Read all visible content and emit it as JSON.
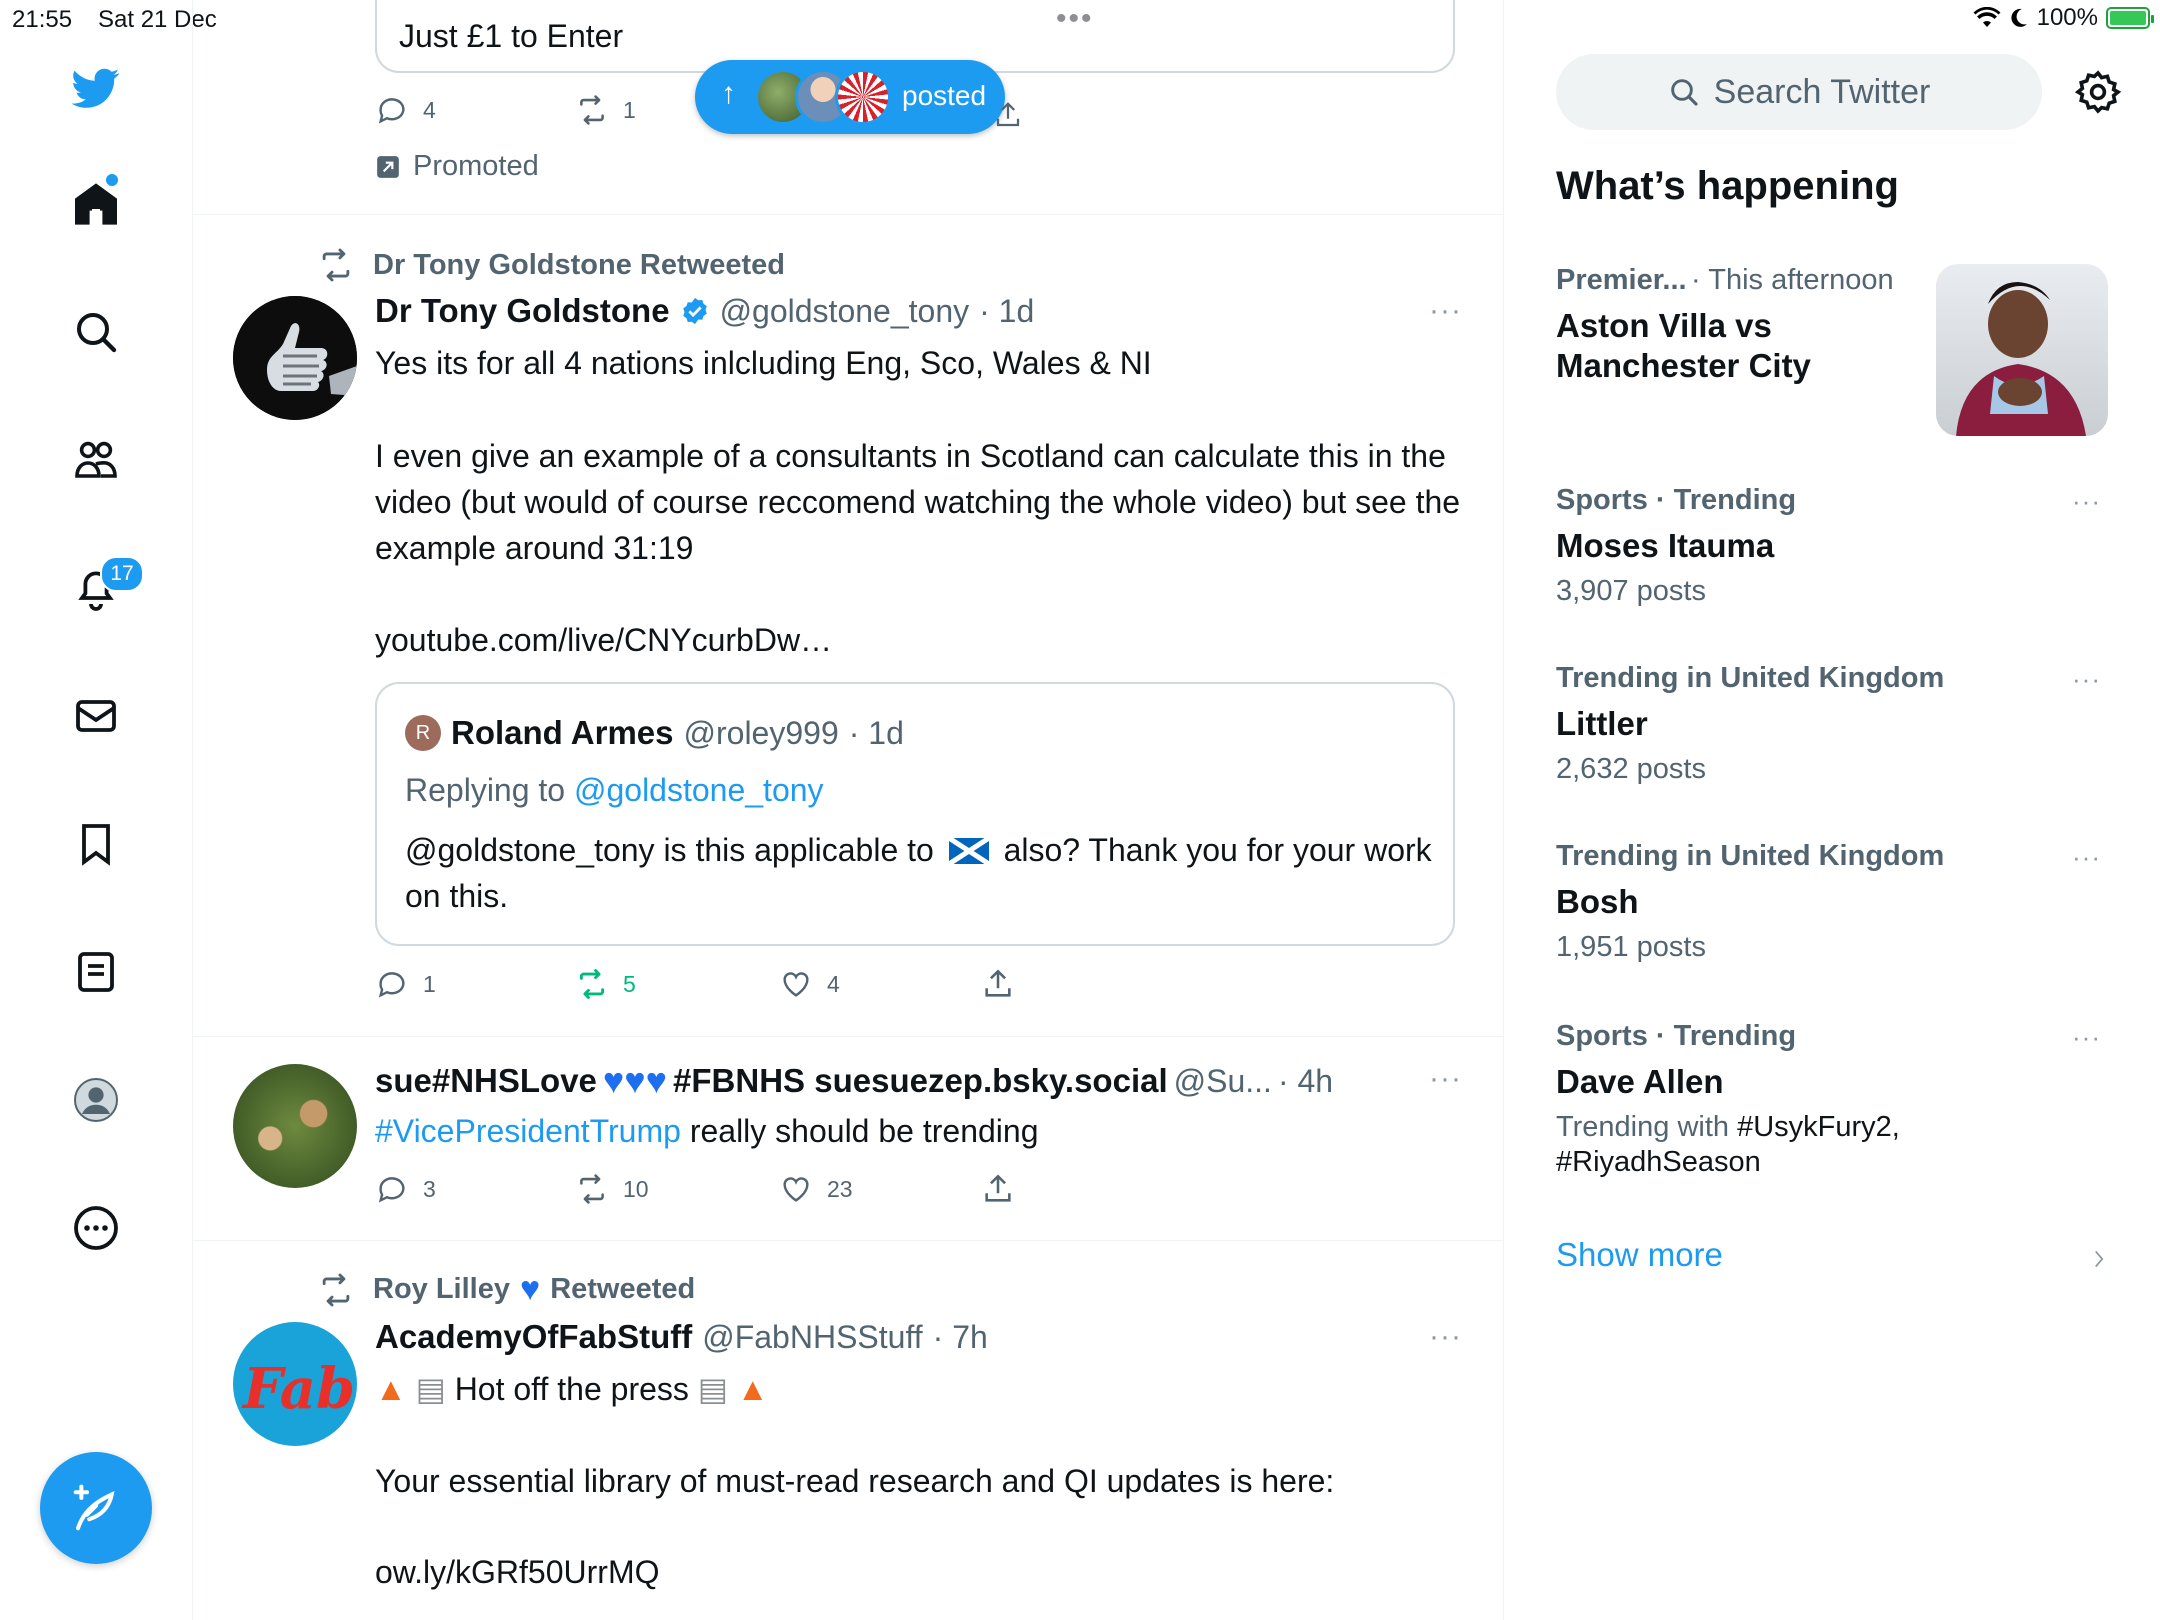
{
  "status_bar": {
    "time": "21:55",
    "date": "Sat 21 Dec",
    "multitask_dots": "•••",
    "battery": "100%"
  },
  "colors": {
    "accent": "#1d9bf0",
    "retweet_green": "#00ba7c",
    "text": "#0f1419",
    "muted": "#536471"
  },
  "nav": {
    "items": [
      {
        "name": "home",
        "icon": "home-icon"
      },
      {
        "name": "explore",
        "icon": "search-icon"
      },
      {
        "name": "communities",
        "icon": "communities-icon"
      },
      {
        "name": "notifications",
        "icon": "bell-icon",
        "badge": "17"
      },
      {
        "name": "messages",
        "icon": "mail-icon"
      },
      {
        "name": "bookmarks",
        "icon": "bookmark-icon"
      },
      {
        "name": "lists",
        "icon": "lists-icon"
      },
      {
        "name": "profile",
        "icon": "profile-icon"
      },
      {
        "name": "more",
        "icon": "more-circle-icon"
      }
    ],
    "compose_icon": "compose-icon"
  },
  "new_posts_pill": {
    "label": "posted"
  },
  "promoted_tweet": {
    "partial_text": "Just £1 to Enter",
    "reply_count": "4",
    "retweet_count": "1",
    "promoted_label": "Promoted"
  },
  "tweets": [
    {
      "social_context": "Dr Tony Goldstone Retweeted",
      "name": "Dr Tony Goldstone",
      "handle": "@goldstone_tony",
      "time": "· 1d",
      "text_line1": "Yes its for all 4 nations inlcluding Eng, Sco, Wales & NI",
      "text_para2": "I even give an example of a consultants in Scotland can calculate this in the video (but would of course reccomend watching the whole video) but see the example around 31:19",
      "link": "youtube.com/live/CNYcurbDw…",
      "quote": {
        "avatar_letter": "R",
        "name": "Roland Armes",
        "handle": "@roley999",
        "time": "· 1d",
        "replying_prefix": "Replying to",
        "replying_handle": "@goldstone_tony",
        "text_before_flag": "@goldstone_tony is this applicable to",
        "text_after_flag": "also?  Thank you for your work on this."
      },
      "reply_count": "1",
      "retweet_count": "5",
      "like_count": "4"
    },
    {
      "name_prefix": "sue#NHSLove",
      "name_suffix": "#FBNHS suesuezep.bsky.social",
      "handle": "@Su...",
      "time": "· 4h",
      "hashtag": "#VicePresidentTrump",
      "text": " really should be trending",
      "reply_count": "3",
      "retweet_count": "10",
      "like_count": "23"
    },
    {
      "social_context_name": "Roy Lilley",
      "social_context_suffix": "Retweeted",
      "name": "AcademyOfFabStuff",
      "handle": "@FabNHSStuff",
      "time": "· 7h",
      "text_line1": "Hot off the press",
      "text_para2": "Your essential library of must-read research and QI updates is here:",
      "link": "ow.ly/kGRf50UrrMQ",
      "avatar_text": "Fab"
    }
  ],
  "sidebar": {
    "search_placeholder": "Search Twitter",
    "section_title": "What’s happening",
    "trends": [
      {
        "meta": "Premier...",
        "meta2": "· This afternoon",
        "title_line1": "Aston Villa vs",
        "title_line2": "Manchester City"
      },
      {
        "meta": "Sports · Trending",
        "title": "Moses Itauma",
        "sub": "3,907 posts"
      },
      {
        "meta": "Trending in United Kingdom",
        "title": "Littler",
        "sub": "2,632 posts"
      },
      {
        "meta": "Trending in United Kingdom",
        "title": "Bosh",
        "sub": "1,951 posts"
      },
      {
        "meta": "Sports · Trending",
        "title": "Dave Allen",
        "sub_prefix": "Trending with ",
        "sub_tags1": "#UsykFury2,",
        "sub_tags2": "#RiyadhSeason"
      }
    ],
    "show_more": "Show more"
  }
}
